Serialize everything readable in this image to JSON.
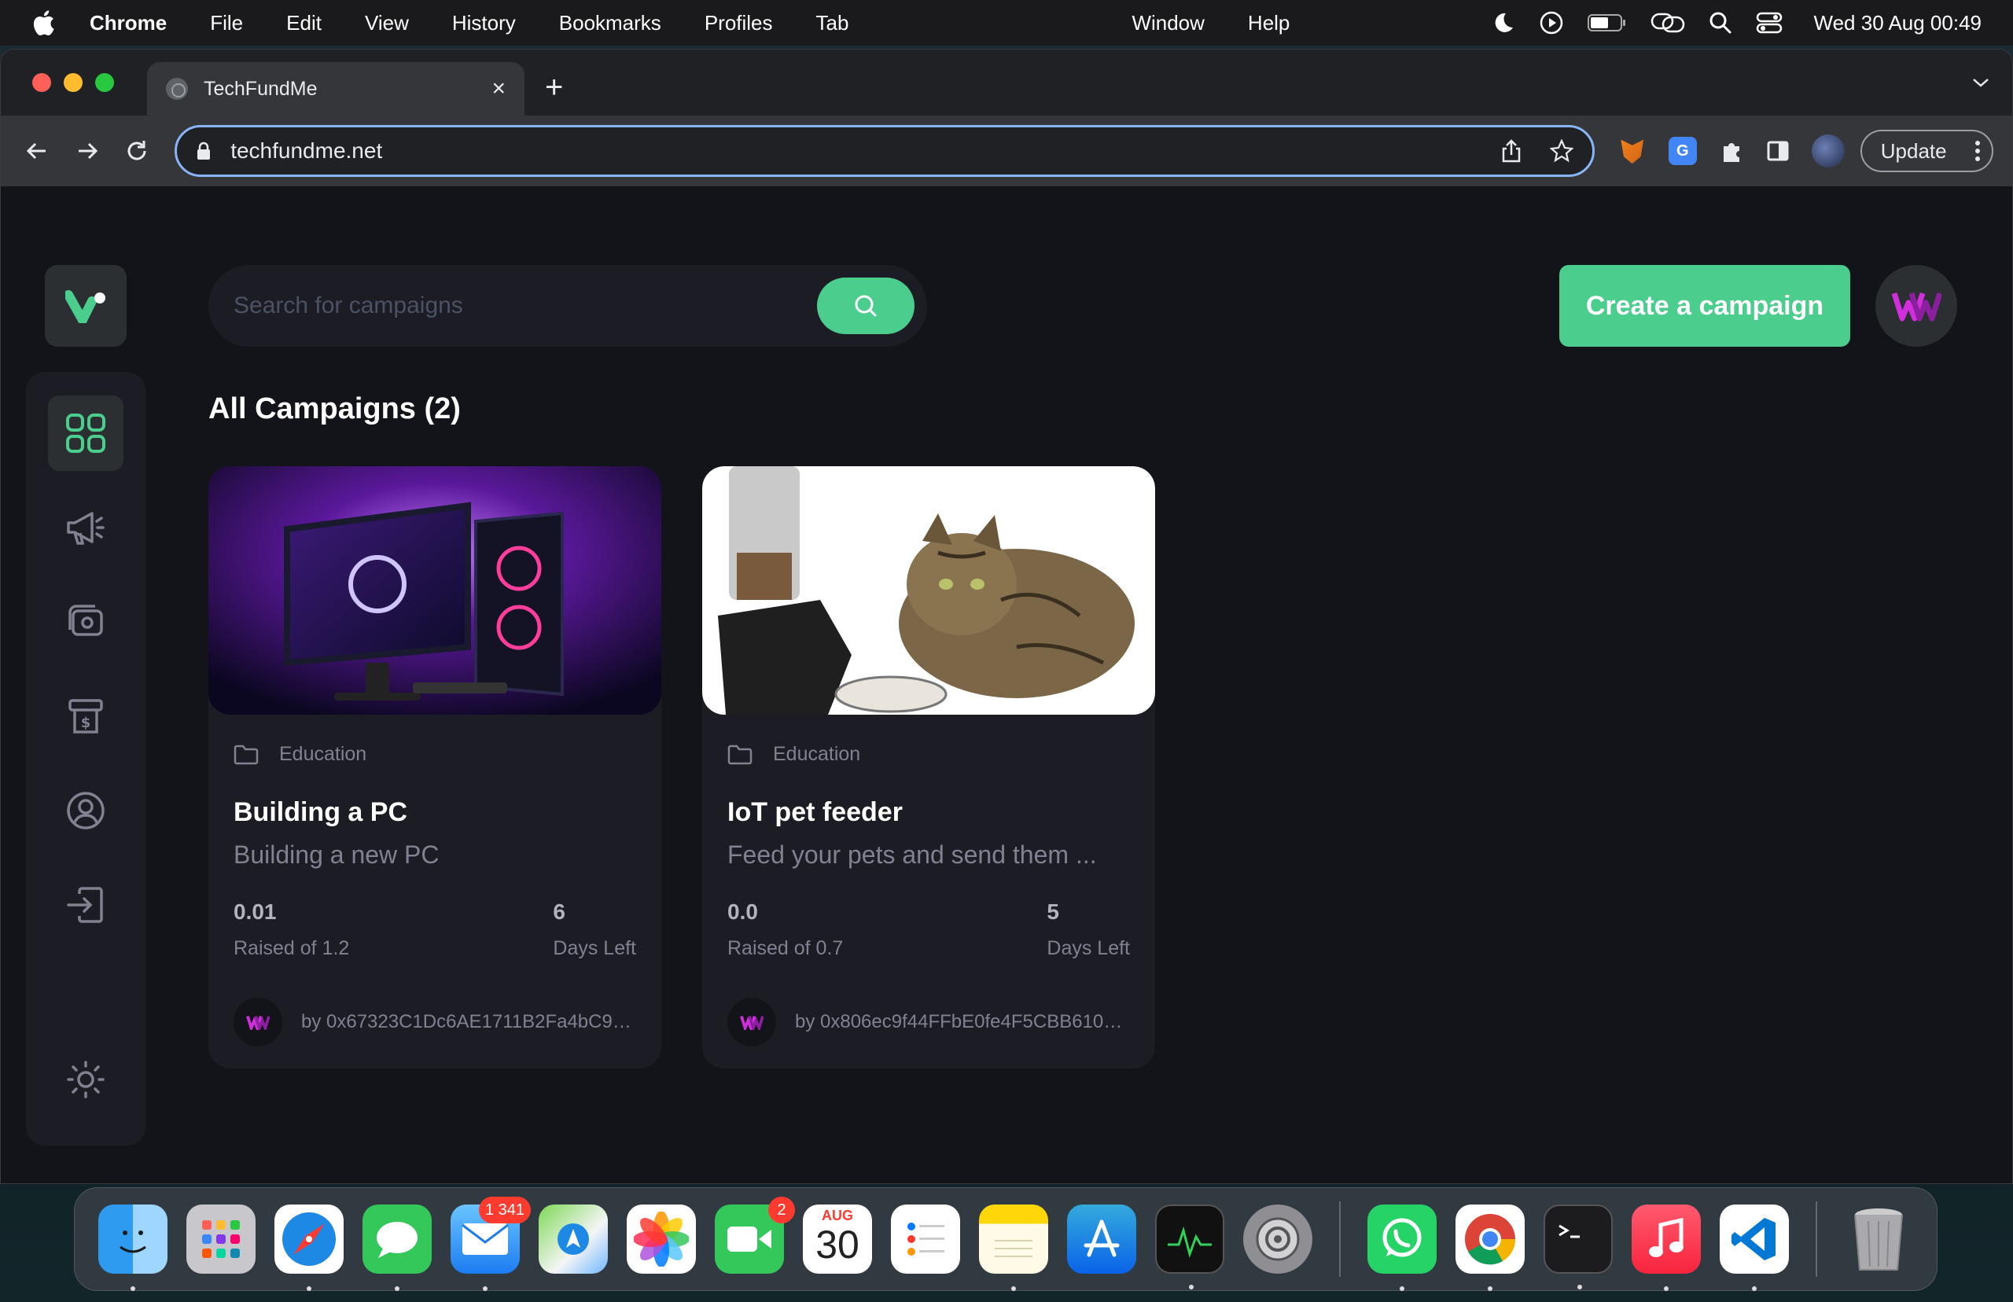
{
  "menubar": {
    "app": "Chrome",
    "items": [
      "File",
      "Edit",
      "View",
      "History",
      "Bookmarks",
      "Profiles",
      "Tab",
      "Window",
      "Help"
    ],
    "clock": "Wed 30 Aug  00:49"
  },
  "browser": {
    "tab_title": "TechFundMe",
    "url": "techfundme.net",
    "update_label": "Update"
  },
  "page": {
    "search_placeholder": "Search for campaigns",
    "create_label": "Create a campaign",
    "section_title": "All Campaigns (2)",
    "campaigns": [
      {
        "category": "Education",
        "title": "Building a PC",
        "description": "Building a new PC",
        "raised": "0.01",
        "raised_label": "Raised of 1.2",
        "days": "6",
        "days_label": "Days Left",
        "owner": "by 0x67323C1Dc6AE1711B2Fa4bC971..."
      },
      {
        "category": "Education",
        "title": "IoT pet feeder",
        "description": "Feed your pets and send them ...",
        "raised": "0.0",
        "raised_label": "Raised of 0.7",
        "days": "5",
        "days_label": "Days Left",
        "owner": "by 0x806ec9f44FFbE0fe4F5CBB6108..."
      }
    ]
  },
  "dock": {
    "mail_badge": "1 341",
    "facetime_badge": "2",
    "calendar_month": "AUG",
    "calendar_day": "30"
  },
  "colors": {
    "accent": "#4acd8d",
    "card_bg": "#1c1c24",
    "page_bg": "#13131a",
    "muted_text": "#808191"
  }
}
